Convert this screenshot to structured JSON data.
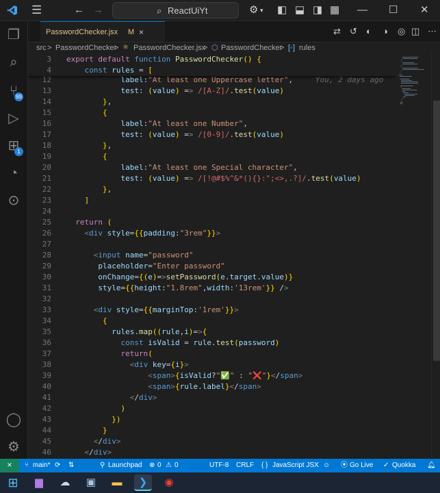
{
  "title_bar": {
    "search_text": "ReactUiYt"
  },
  "tab": {
    "filename": "PasswordChecker.jsx",
    "modified_marker": "M",
    "close": "×"
  },
  "breadcrumb": {
    "items": [
      "src",
      "PasswordChecker",
      "PasswordChecker.jsx",
      "PasswordChecker",
      "rules"
    ],
    "separator": ">"
  },
  "activity_badges": {
    "source_control": "99",
    "extensions": "1"
  },
  "editor": {
    "sticky": [
      {
        "n": "3",
        "t": "export default function PasswordChecker() {"
      },
      {
        "n": "4",
        "t": "    const rules = ["
      }
    ],
    "lines": [
      {
        "n": "12",
        "t": "            label:\"At least one Uppercase letter\","
      },
      {
        "n": "13",
        "t": "            test: (value) => /[A-Z]/.test(value)"
      },
      {
        "n": "14",
        "t": "        },"
      },
      {
        "n": "15",
        "t": "        {"
      },
      {
        "n": "16",
        "t": "            label:\"At least one Number\","
      },
      {
        "n": "17",
        "t": "            test: (value) => /[0-9]/.test(value)"
      },
      {
        "n": "18",
        "t": "        },"
      },
      {
        "n": "19",
        "t": "        {"
      },
      {
        "n": "20",
        "t": "            label:\"At least one Special character\","
      },
      {
        "n": "21",
        "t": "            test: (value) => /[!@#$%^&*(){}:\";<>,.?]/.test(value)"
      },
      {
        "n": "22",
        "t": "        },"
      },
      {
        "n": "23",
        "t": "    ]"
      },
      {
        "n": "24",
        "t": ""
      },
      {
        "n": "25",
        "t": "  return ("
      },
      {
        "n": "26",
        "t": "    <div style={{padding:\"3rem\"}}>"
      },
      {
        "n": "27",
        "t": ""
      },
      {
        "n": "28",
        "t": "      <input name=\"password\""
      },
      {
        "n": "29",
        "t": "       placeholder=\"Enter password\""
      },
      {
        "n": "30",
        "t": "       onChange={(e)=>setPassword(e.target.value)}"
      },
      {
        "n": "31",
        "t": "       style={{height:\"1.8rem\",width:'13rem'}} />"
      },
      {
        "n": "32",
        "t": ""
      },
      {
        "n": "33",
        "t": "      <div style={{marginTop:'1rem'}}>"
      },
      {
        "n": "34",
        "t": "        {"
      },
      {
        "n": "35",
        "t": "          rules.map((rule,i)=>{"
      },
      {
        "n": "36",
        "t": "            const isValid = rule.test(password)"
      },
      {
        "n": "37",
        "t": "            return("
      },
      {
        "n": "38",
        "t": "              <div key={i}>"
      },
      {
        "n": "39",
        "t": "                  <span>{isValid?\"✅\" : \"❌\"}</span>"
      },
      {
        "n": "40",
        "t": "                  <span>{rule.label}</span>"
      },
      {
        "n": "41",
        "t": "              </div>"
      },
      {
        "n": "42",
        "t": "            )"
      },
      {
        "n": "43",
        "t": "          })"
      },
      {
        "n": "44",
        "t": "        }"
      },
      {
        "n": "45",
        "t": "      </div>"
      },
      {
        "n": "46",
        "t": "    </div>"
      }
    ],
    "blame": "You, 2 days ago"
  },
  "status_bar": {
    "branch": "main*",
    "launchpad": "Launchpad",
    "errors": "0",
    "warnings": "0",
    "encoding": "UTF-8",
    "eol": "CRLF",
    "language": "JavaScript JSX",
    "golive": "Go Live",
    "quokka": "Quokka"
  },
  "colors": {
    "accent": "#0078d4",
    "editor_bg": "#1f1f1f",
    "taskbar_bg": "#1c2533"
  }
}
